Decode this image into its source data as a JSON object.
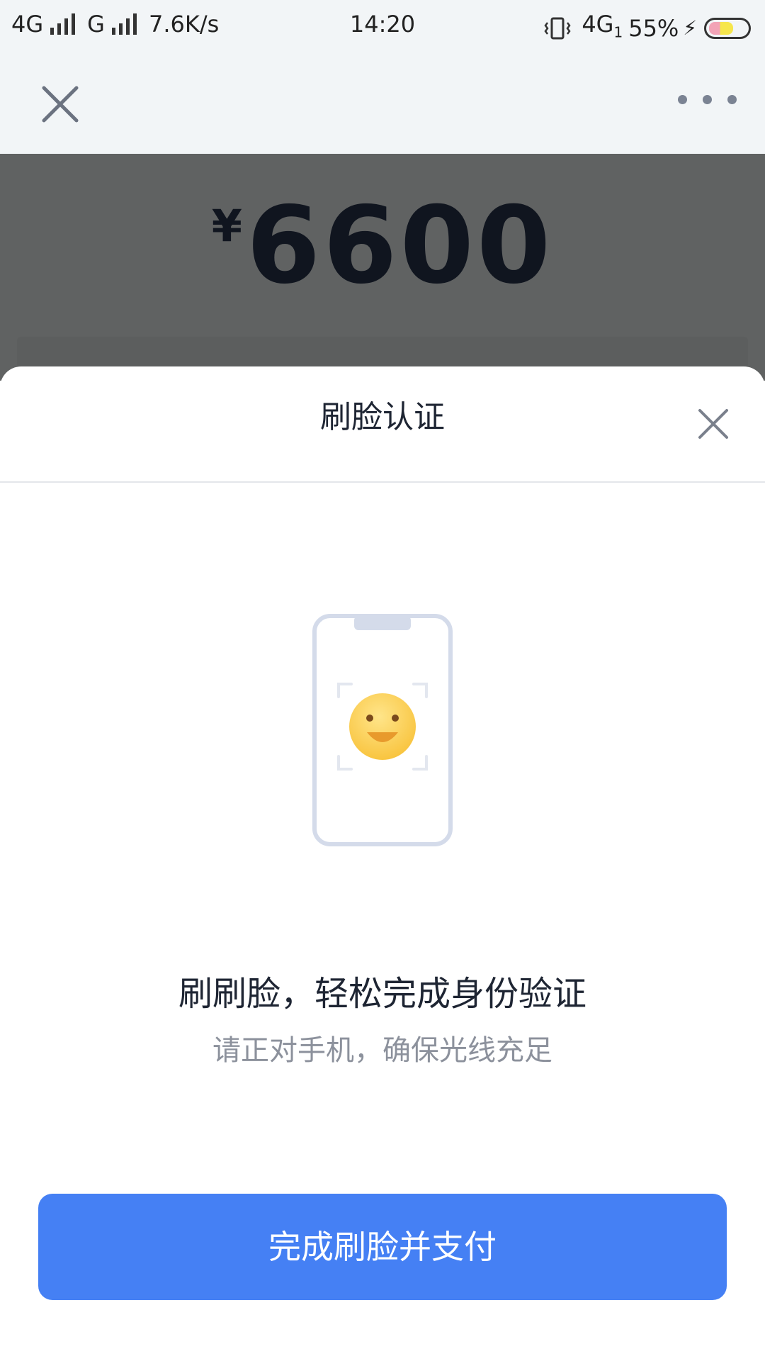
{
  "status_bar": {
    "network1": "4G",
    "network2": "G",
    "speed": "7.6K/s",
    "time": "14:20",
    "network3": "4G",
    "network3_sub": "1",
    "battery": "55%",
    "icons": [
      "signal-icon",
      "vibrate-icon",
      "battery-icon",
      "charging-icon"
    ]
  },
  "nav": {
    "icons": [
      "close-icon",
      "more-icon"
    ]
  },
  "payment": {
    "currency": "¥",
    "amount": "6600"
  },
  "sheet": {
    "title": "刷脸认证",
    "headline": "刷刷脸，轻松完成身份验证",
    "subline": "请正对手机，确保光线充足",
    "button_label": "完成刷脸并支付",
    "icons": [
      "close-icon",
      "face-scan-illustration"
    ]
  },
  "colors": {
    "accent": "#4580f4",
    "dim_overlay": "#606262",
    "status_bar_bg": "#f2f5f7"
  }
}
